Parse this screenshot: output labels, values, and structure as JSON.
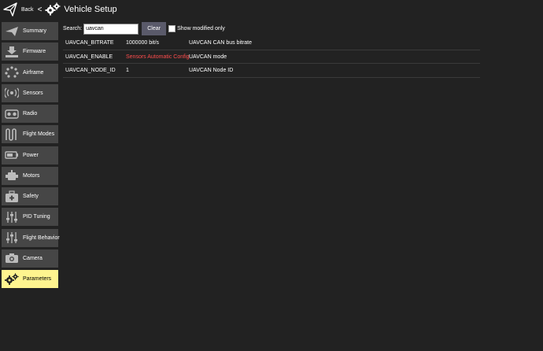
{
  "header": {
    "back_label": "Back",
    "separator": "<",
    "title": "Vehicle Setup"
  },
  "sidebar": {
    "items": [
      {
        "label": "Summary",
        "icon": "plane-icon",
        "active": false
      },
      {
        "label": "Firmware",
        "icon": "firmware-download-icon",
        "active": false
      },
      {
        "label": "Airframe",
        "icon": "airframe-icon",
        "active": false
      },
      {
        "label": "Sensors",
        "icon": "sensors-icon",
        "active": false
      },
      {
        "label": "Radio",
        "icon": "radio-icon",
        "active": false
      },
      {
        "label": "Flight Modes",
        "icon": "flight-modes-icon",
        "active": false
      },
      {
        "label": "Power",
        "icon": "battery-icon",
        "active": false
      },
      {
        "label": "Motors",
        "icon": "motor-icon",
        "active": false
      },
      {
        "label": "Safety",
        "icon": "safety-icon",
        "active": false
      },
      {
        "label": "PID Tuning",
        "icon": "sliders-icon",
        "active": false
      },
      {
        "label": "Flight Behavior",
        "icon": "sliders-icon",
        "active": false
      },
      {
        "label": "Camera",
        "icon": "camera-icon",
        "active": false
      },
      {
        "label": "Parameters",
        "icon": "gears-icon",
        "active": true
      }
    ]
  },
  "search": {
    "label": "Search:",
    "value": "uavcan",
    "clear_label": "Clear",
    "show_modified_label": "Show modified only"
  },
  "params": [
    {
      "name": "UAVCAN_BITRATE",
      "value": "1000000 bit/s",
      "description": "UAVCAN CAN bus bitrate",
      "modified": false
    },
    {
      "name": "UAVCAN_ENABLE",
      "value": "Sensors Automatic Config",
      "description": "UAVCAN mode",
      "modified": true
    },
    {
      "name": "UAVCAN_NODE_ID",
      "value": "1",
      "description": "UAVCAN Node ID",
      "modified": false
    }
  ],
  "colors": {
    "background": "#222222",
    "sidebar_item": "#464646",
    "active_item": "#fef48f",
    "modified_value": "#ff4d4d",
    "clear_button": "#5a5a6a"
  }
}
